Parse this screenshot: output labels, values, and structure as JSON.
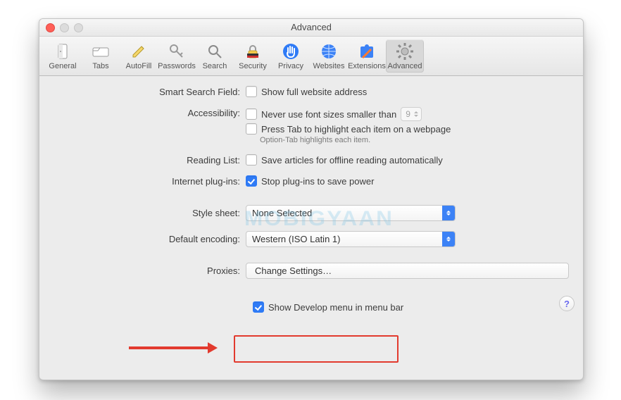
{
  "window": {
    "title": "Advanced"
  },
  "toolbar": {
    "items": [
      {
        "label": "General"
      },
      {
        "label": "Tabs"
      },
      {
        "label": "AutoFill"
      },
      {
        "label": "Passwords"
      },
      {
        "label": "Search"
      },
      {
        "label": "Security"
      },
      {
        "label": "Privacy"
      },
      {
        "label": "Websites"
      },
      {
        "label": "Extensions"
      },
      {
        "label": "Advanced"
      }
    ]
  },
  "labels": {
    "smart_search": "Smart Search Field:",
    "accessibility": "Accessibility:",
    "reading_list": "Reading List:",
    "plugins": "Internet plug-ins:",
    "stylesheet": "Style sheet:",
    "encoding": "Default encoding:",
    "proxies": "Proxies:"
  },
  "options": {
    "show_full_url": "Show full website address",
    "never_font_prefix": "Never use font sizes smaller than",
    "never_font_value": "9",
    "press_tab": "Press Tab to highlight each item on a webpage",
    "option_tab_note": "Option-Tab highlights each item.",
    "save_offline": "Save articles for offline reading automatically",
    "stop_plugins": "Stop plug-ins to save power",
    "stylesheet_value": "None Selected",
    "encoding_value": "Western (ISO Latin 1)",
    "change_settings": "Change Settings…",
    "show_develop": "Show Develop menu in menu bar"
  },
  "help": "?",
  "watermark": "MOBIGYAAN"
}
